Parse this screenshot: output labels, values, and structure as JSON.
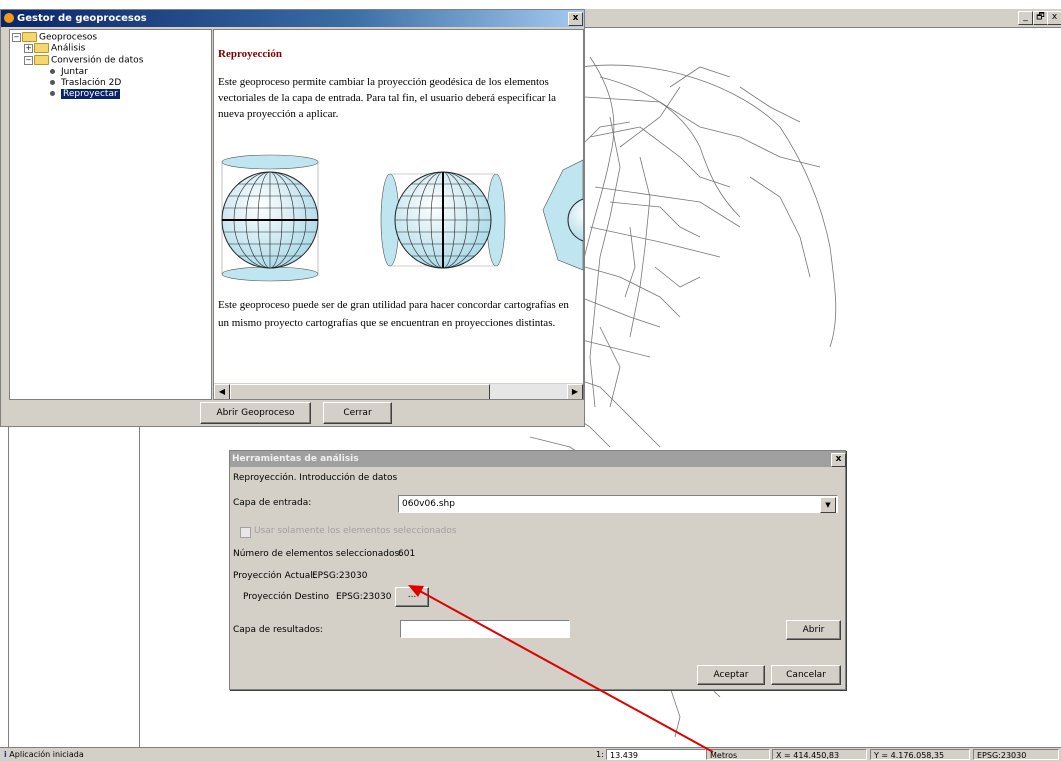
{
  "app": {
    "topbar_buttons": [
      "_",
      "🗗",
      "x"
    ],
    "status": {
      "message": "Aplicación iniciada",
      "scale_prefix": "1:",
      "scale": "13.439",
      "units": "Metros",
      "x": "X = 414.450,83",
      "y": "Y = 4.176.058,35",
      "crs": "EPSG:23030"
    }
  },
  "geomanager": {
    "title": "Gestor de geoprocesos",
    "close": "x",
    "tree": {
      "root": "Geoprocesos",
      "analysis": "Análisis",
      "conversion": "Conversión de datos",
      "items": [
        "Juntar",
        "Traslación 2D",
        "Reproyectar"
      ]
    },
    "content": {
      "title": "Reproyección",
      "p1": "Este geoproceso permite cambiar la proyección geodésica de los elementos vectoriales de la capa de entrada. Para tal fin, el usuario deberá especificar la nueva proyección a aplicar.",
      "p2": "Este geoproceso puede ser de gran utilidad para hacer concordar cartografías en un mismo proyecto cartografías que se encuentran en proyecciones distintas."
    },
    "buttons": {
      "open": "Abrir Geoproceso",
      "close": "Cerrar"
    }
  },
  "dialog": {
    "title": "Herramientas de análisis",
    "close": "x",
    "subtitle": "Reproyección. Introducción de datos",
    "input_label": "Capa de entrada:",
    "input_value": "060v06.shp",
    "checkbox_label": "Usar solamente los elementos seleccionados",
    "count_label": "Número de elementos seleccionados:",
    "count_value": "601",
    "current_proj_label": "Proyección Actual:",
    "current_proj_value": "EPSG:23030",
    "dest_proj_label": "Proyección Destino",
    "dest_proj_value": "EPSG:23030",
    "dest_button": "...",
    "output_label": "Capa de resultados:",
    "output_value": "",
    "open_button": "Abrir",
    "accept_button": "Aceptar",
    "cancel_button": "Cancelar"
  },
  "colors": {
    "annotation_arrow": "#e00000",
    "title_accent": "#800000",
    "dialog_title_bg": "#a0a0a0"
  }
}
